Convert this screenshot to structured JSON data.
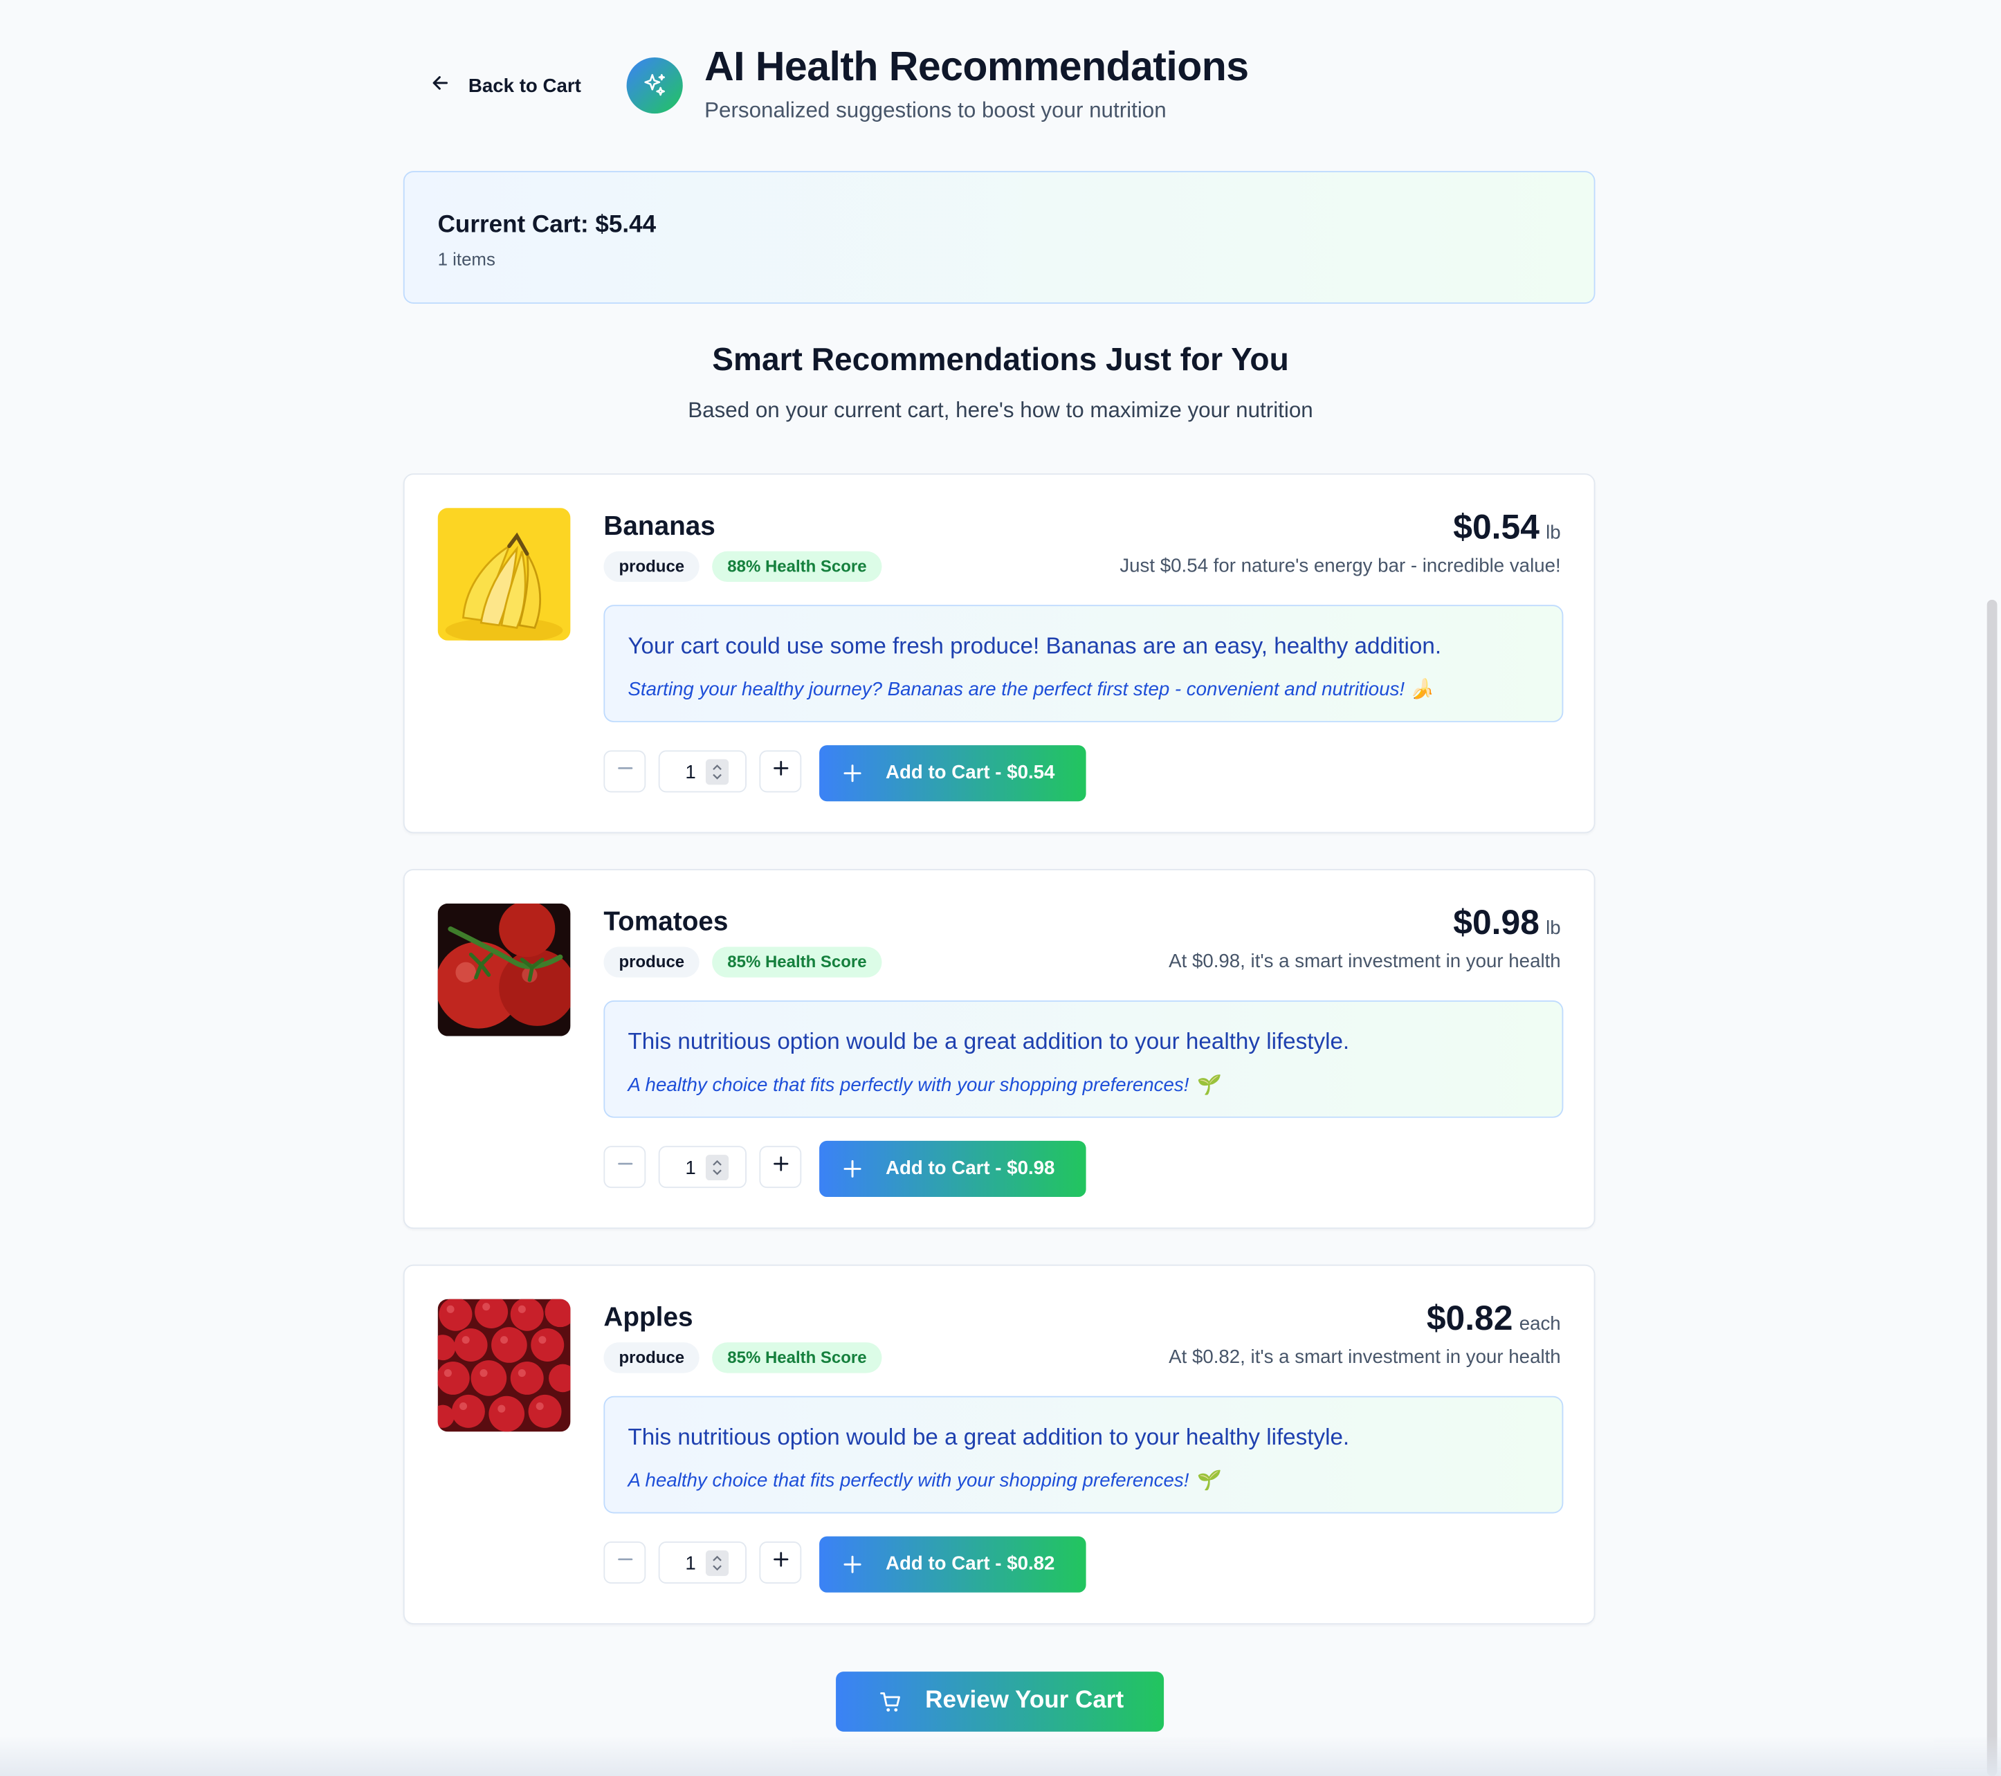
{
  "header": {
    "back_label": "Back to Cart",
    "title": "AI Health Recommendations",
    "subtitle": "Personalized suggestions to boost your nutrition"
  },
  "cart_summary": {
    "total_label": "Current Cart: $5.44",
    "items_label": "1 items"
  },
  "section": {
    "title": "Smart Recommendations Just for You",
    "subtitle": "Based on your current cart, here's how to maximize your nutrition"
  },
  "products": [
    {
      "name": "Bananas",
      "category": "produce",
      "health_score": "88% Health Score",
      "price": "$0.54",
      "unit": "lb",
      "price_note": "Just $0.54 for nature's energy bar - incredible value!",
      "recommendation": "Your cart could use some fresh produce! Bananas are an easy, healthy addition.",
      "note": "Starting your healthy journey? Bananas are the perfect first step - convenient and nutritious! 🍌",
      "quantity": "1",
      "add_label": "Add to Cart - $0.54",
      "image": "bananas-image"
    },
    {
      "name": "Tomatoes",
      "category": "produce",
      "health_score": "85% Health Score",
      "price": "$0.98",
      "unit": "lb",
      "price_note": "At $0.98, it's a smart investment in your health",
      "recommendation": "This nutritious option would be a great addition to your healthy lifestyle.",
      "note": "A healthy choice that fits perfectly with your shopping preferences! 🌱",
      "quantity": "1",
      "add_label": "Add to Cart - $0.98",
      "image": "tomatoes-image"
    },
    {
      "name": "Apples",
      "category": "produce",
      "health_score": "85% Health Score",
      "price": "$0.82",
      "unit": "each",
      "price_note": "At $0.82, it's a smart investment in your health",
      "recommendation": "This nutritious option would be a great addition to your healthy lifestyle.",
      "note": "A healthy choice that fits perfectly with your shopping preferences! 🌱",
      "quantity": "1",
      "add_label": "Add to Cart - $0.82",
      "image": "apples-image"
    }
  ],
  "review_button_label": "Review Your Cart",
  "colors": {
    "accent_start": "#3b82f6",
    "accent_end": "#22c55e",
    "score_badge_bg": "#dcfce7",
    "score_badge_text": "#15803d",
    "reco_text": "#1e40af"
  },
  "icons": {
    "back": "arrow-left-icon",
    "brand": "sparkles-icon",
    "minus": "minus-icon",
    "plus": "plus-icon",
    "spinner": "chevron-up-down-icon",
    "cart": "shopping-cart-icon"
  }
}
